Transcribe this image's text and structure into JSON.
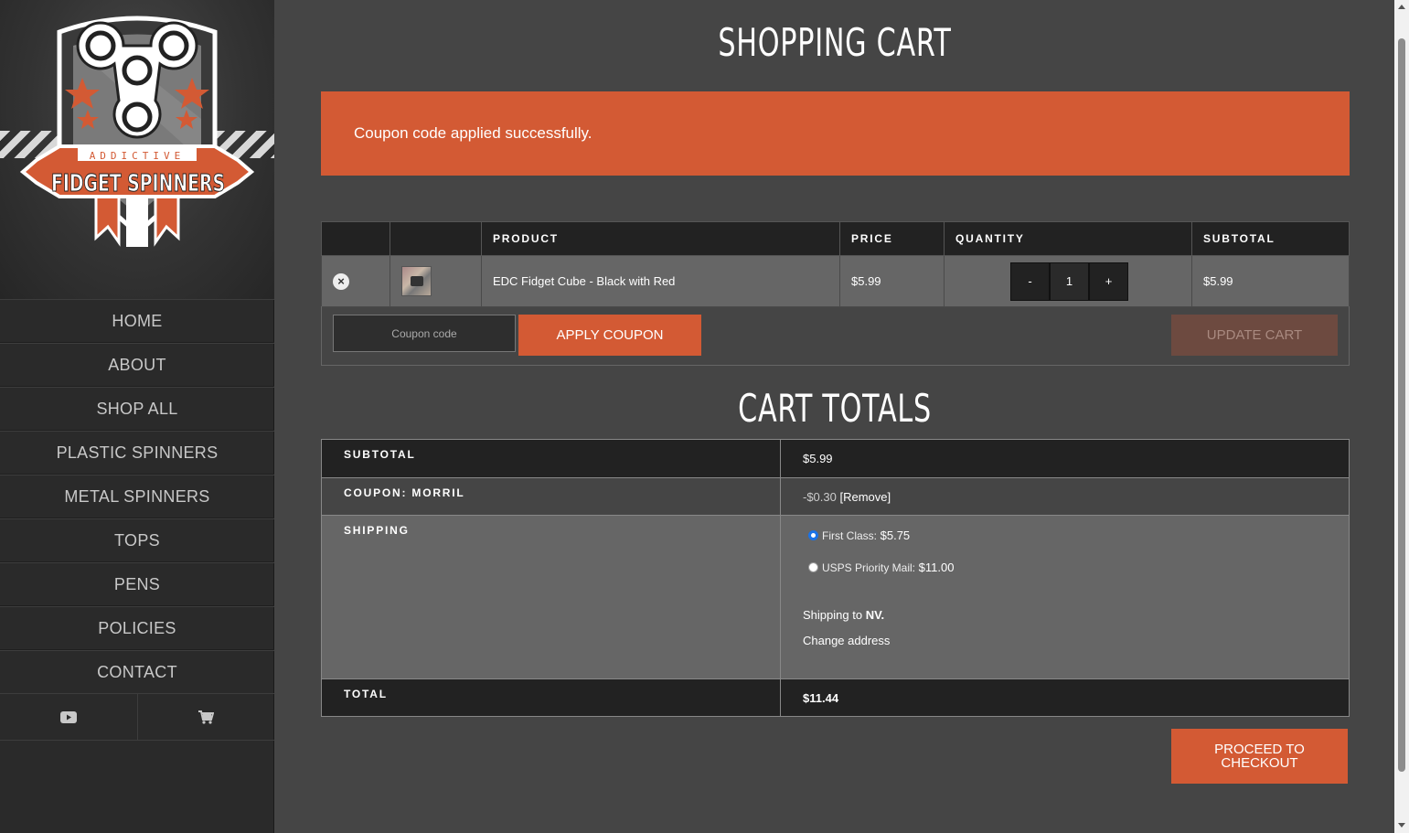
{
  "brand": {
    "top_text": "ADDICTIVE",
    "name": "FIDGET SPINNERS",
    "accent": "#d35a34"
  },
  "nav": [
    {
      "label": "HOME"
    },
    {
      "label": "ABOUT"
    },
    {
      "label": "SHOP ALL"
    },
    {
      "label": "PLASTIC SPINNERS"
    },
    {
      "label": "METAL SPINNERS"
    },
    {
      "label": "TOPS"
    },
    {
      "label": "PENS"
    },
    {
      "label": "POLICIES"
    },
    {
      "label": "CONTACT"
    }
  ],
  "social": [
    {
      "icon": "youtube-icon"
    },
    {
      "icon": "cart-icon"
    }
  ],
  "page": {
    "title": "SHOPPING CART"
  },
  "notice": "Coupon code applied successfully.",
  "cart": {
    "headers": [
      "",
      "",
      "PRODUCT",
      "PRICE",
      "QUANTITY",
      "SUBTOTAL"
    ],
    "items": [
      {
        "product": "EDC Fidget Cube - Black with Red",
        "price": "$5.99",
        "qty": "1",
        "subtotal": "$5.99",
        "minus": "-",
        "plus": "+"
      }
    ],
    "coupon_placeholder": "Coupon code",
    "apply_label": "APPLY COUPON",
    "update_label": "UPDATE CART"
  },
  "totals": {
    "title": "CART TOTALS",
    "subtotal_label": "SUBTOTAL",
    "subtotal": "$5.99",
    "coupon_label": "COUPON: MORRIL",
    "coupon_amount": "-$0.30",
    "coupon_remove": "[Remove]",
    "shipping_label": "SHIPPING",
    "shipping_options": [
      {
        "name": "First Class:",
        "price": "$5.75",
        "selected": true
      },
      {
        "name": "USPS Priority Mail:",
        "price": "$11.00",
        "selected": false
      }
    ],
    "shipping_to_prefix": "Shipping to",
    "shipping_to_state": "NV.",
    "change_address": "Change address",
    "total_label": "TOTAL",
    "total": "$11.44"
  },
  "checkout": {
    "line1": "PROCEED TO",
    "line2": "CHECKOUT"
  }
}
